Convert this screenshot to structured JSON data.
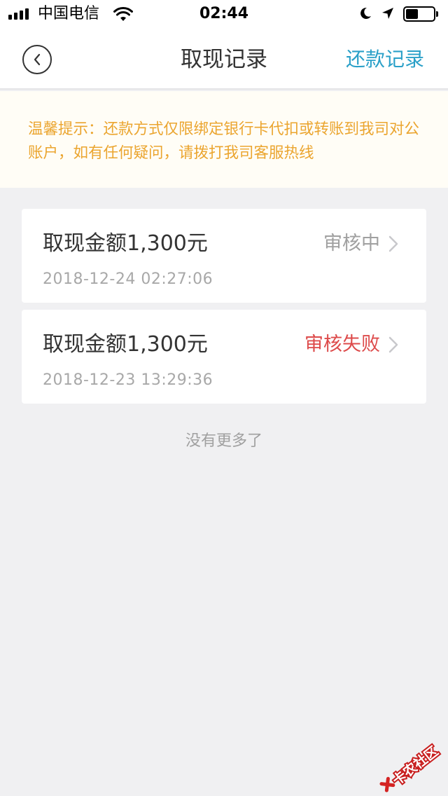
{
  "status_bar": {
    "carrier": "中国电信",
    "time": "02:44",
    "signal_bars": 4,
    "battery_level": 0.45
  },
  "nav": {
    "title": "取现记录",
    "right_link": "还款记录",
    "back_icon": "chevron-left-circle-icon"
  },
  "notice": {
    "text": "温馨提示：还款方式仅限绑定银行卡代扣或转账到我司对公账户，如有任何疑问，请拨打我司客服热线"
  },
  "records": [
    {
      "amount_label": "取现金额1,300元",
      "datetime": "2018-12-24 02:27:06",
      "status": "审核中",
      "status_color": "#a0a0a0"
    },
    {
      "amount_label": "取现金额1,300元",
      "datetime": "2018-12-23 13:29:36",
      "status": "审核失败",
      "status_color": "#dd4b4b"
    }
  ],
  "footer": {
    "no_more": "没有更多了"
  },
  "watermark": {
    "text": "卡农社区"
  },
  "colors": {
    "accent": "#2aa0c8",
    "notice_text": "#eba52f",
    "notice_bg": "#fffdf6",
    "page_bg": "#f0f0f2"
  }
}
